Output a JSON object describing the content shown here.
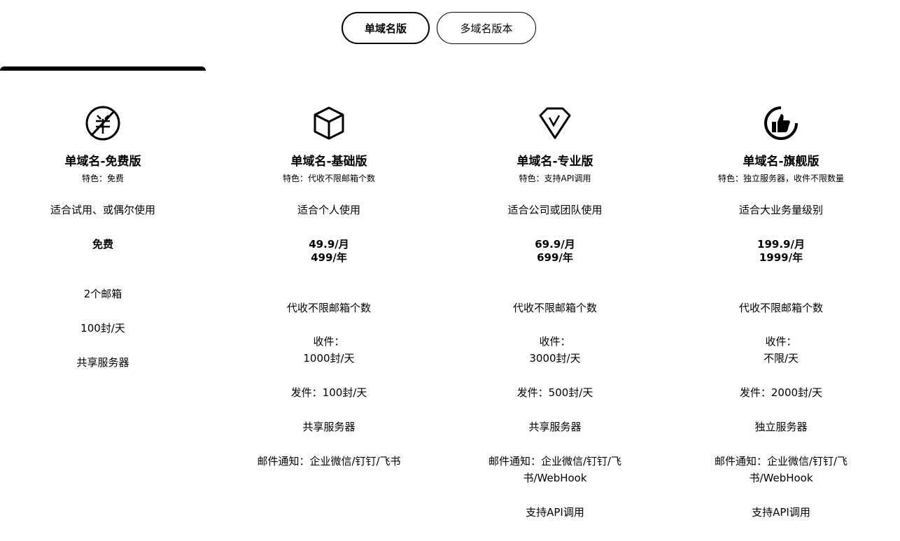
{
  "tabs": {
    "single": "单域名版",
    "multi": "多域名版本"
  },
  "plans": [
    {
      "icon": "no-yen-icon",
      "name": "单域名-免费版",
      "feature": "特色：免费",
      "fit": "适合试用、或偶尔使用",
      "price_line1": "免费",
      "price_line2": "",
      "details": [
        "2个邮箱",
        "100封/天",
        "共享服务器"
      ]
    },
    {
      "icon": "box-icon",
      "name": "单域名-基础版",
      "feature": "特色：代收不限邮箱个数",
      "fit": "适合个人使用",
      "price_line1": "49.9/月",
      "price_line2": "499/年",
      "details": [
        "代收不限邮箱个数",
        "收件：\n1000封/天",
        "发件：100封/天",
        "共享服务器",
        "邮件通知：企业微信/钉钉/飞书"
      ]
    },
    {
      "icon": "diamond-icon",
      "name": "单域名-专业版",
      "feature": "特色：支持API调用",
      "fit": "适合公司或团队使用",
      "price_line1": "69.9/月",
      "price_line2": "699/年",
      "details": [
        "代收不限邮箱个数",
        "收件：\n3000封/天",
        "发件：500封/天",
        "共享服务器",
        "邮件通知：企业微信/钉钉/飞书/WebHook",
        "支持API调用"
      ]
    },
    {
      "icon": "thumbs-up-icon",
      "name": "单域名-旗舰版",
      "feature": "特色：独立服务器，收件不限数量",
      "fit": "适合大业务量级别",
      "price_line1": "199.9/月",
      "price_line2": "1999/年",
      "details": [
        "代收不限邮箱个数",
        "收件：\n不限/天",
        "发件：2000封/天",
        "独立服务器",
        "邮件通知：企业微信/钉钉/飞书/WebHook",
        "支持API调用"
      ]
    }
  ]
}
